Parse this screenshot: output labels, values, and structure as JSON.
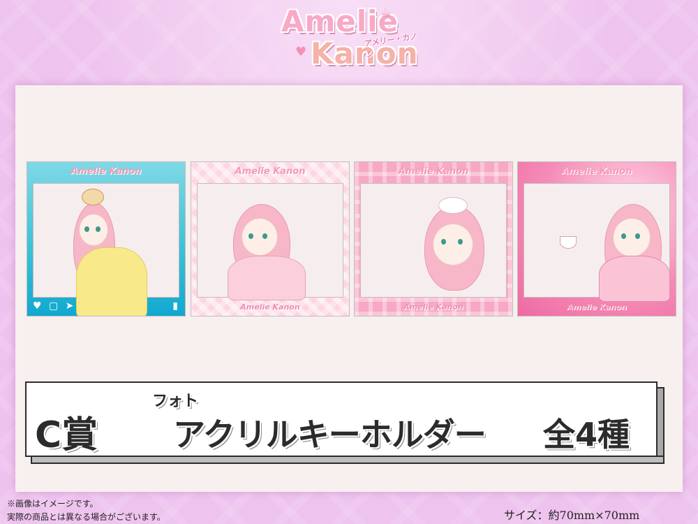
{
  "logo": {
    "line1": "Amelie",
    "line2": "Kanon",
    "subtitle": "アメリー・カノン"
  },
  "cards": [
    {
      "brand_top": "Amelie Kanon",
      "brand_bottom": "",
      "theme": "sky-blue social frame"
    },
    {
      "brand_top": "Amelie Kanon",
      "brand_bottom": "Amelie Kanon",
      "theme": "pink plaid"
    },
    {
      "brand_top": "Amelie Kanon",
      "brand_bottom": "Amelie Kanon",
      "theme": "pink lace"
    },
    {
      "brand_top": "Amelie Kanon",
      "brand_bottom": "Amelie Kanon",
      "theme": "pink sparkle"
    }
  ],
  "banner": {
    "prize": "C賞",
    "ruby": "フォト",
    "title": "アクリルキーホルダー",
    "count": "全4種"
  },
  "notes": {
    "line1": "※画像はイメージです。",
    "line2": "実際の商品とは異なる場合がございます。"
  },
  "size": "サイズ：約70mm×70mm",
  "colors": {
    "background": "#eec3ee",
    "panel": "#f7f0ef",
    "accent_pink": "#f29ab8",
    "text_dark": "#2b2b2b"
  }
}
